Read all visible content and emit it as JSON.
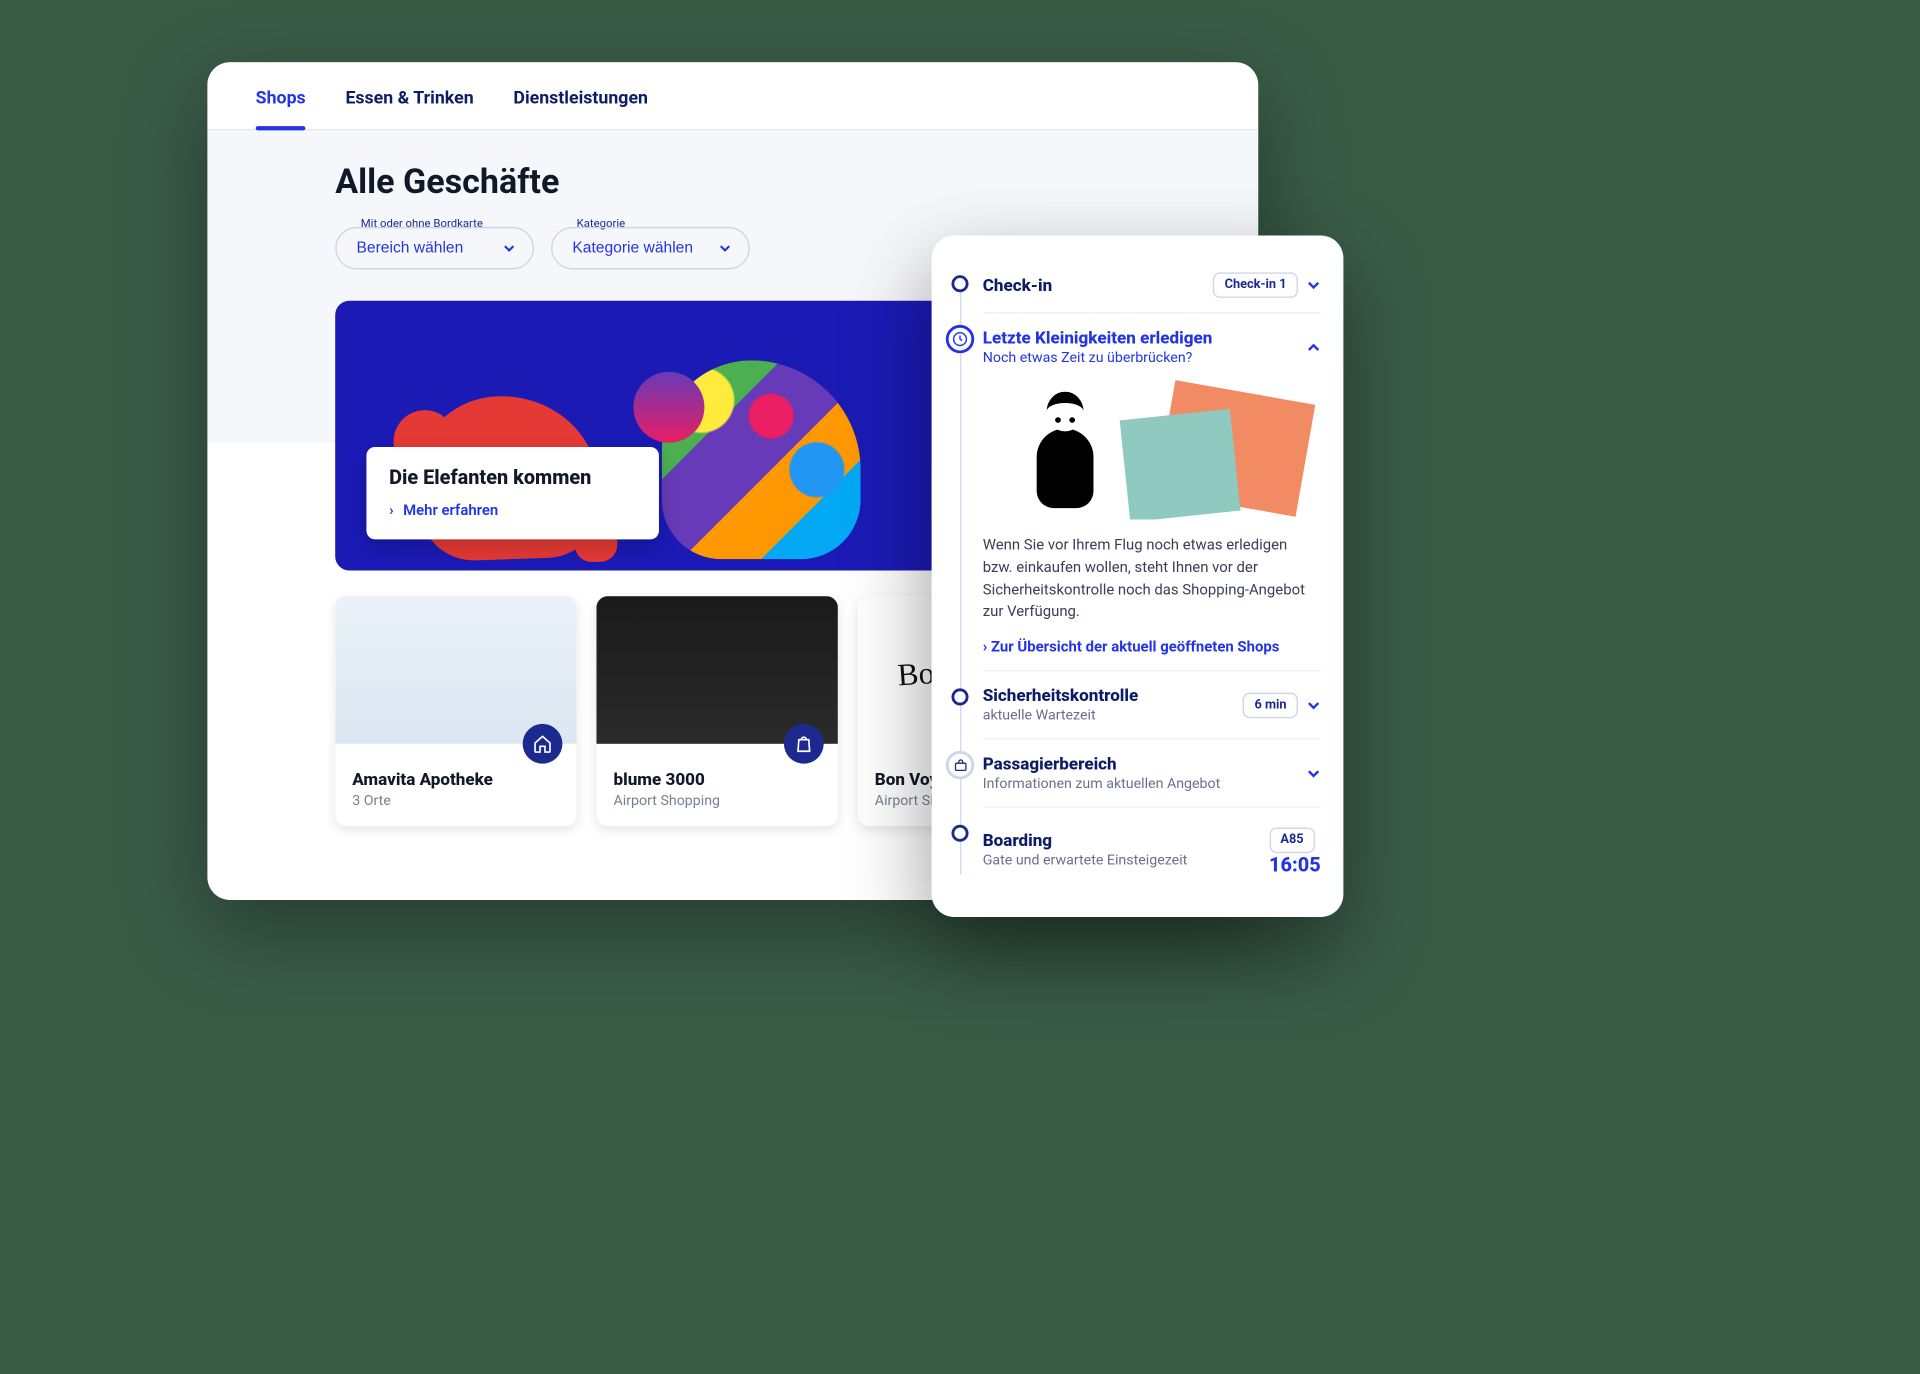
{
  "desktop": {
    "tabs": [
      {
        "label": "Shops",
        "active": true
      },
      {
        "label": "Essen & Trinken",
        "active": false
      },
      {
        "label": "Dienstleistungen",
        "active": false
      }
    ],
    "page_title": "Alle Geschäfte",
    "filters": [
      {
        "label": "Mit oder ohne Bordkarte",
        "value": "Bereich wählen"
      },
      {
        "label": "Kategorie",
        "value": "Kategorie wählen"
      }
    ],
    "hero": {
      "title": "Die Elefanten kommen",
      "link": "Mehr erfahren"
    },
    "shops": [
      {
        "name": "Amavita Apotheke",
        "subtitle": "3 Orte",
        "icon": "home-icon"
      },
      {
        "name": "blume 3000",
        "subtitle": "Airport Shopping",
        "icon": "shopping-bag-icon"
      },
      {
        "name": "Bon Voyage",
        "subtitle": "Airport Shopping",
        "icon": "shopping-bag-icon",
        "script_text": "Bon Voyage!"
      }
    ]
  },
  "mobile": {
    "steps": {
      "checkin": {
        "title": "Check-in",
        "chip": "Check-in 1"
      },
      "shopping": {
        "title": "Letzte Kleinigkeiten erledigen",
        "subtitle": "Noch etwas Zeit zu überbrücken?",
        "body": "Wenn Sie vor Ihrem Flug noch etwas erledigen bzw. einkaufen wollen, steht Ihnen vor der Sicherheitskontrolle noch das Shopping-Angebot zur Verfügung.",
        "link": "Zur Übersicht der aktuell geöffneten Shops"
      },
      "security": {
        "title": "Sicherheitskontrolle",
        "subtitle": "aktuelle Wartezeit",
        "chip": "6 min"
      },
      "passenger": {
        "title": "Passagierbereich",
        "subtitle": "Informationen zum aktuellen Angebot"
      },
      "boarding": {
        "title": "Boarding",
        "subtitle": "Gate und erwartete Einsteigezeit",
        "chip": "A85",
        "time": "16:05"
      }
    }
  }
}
